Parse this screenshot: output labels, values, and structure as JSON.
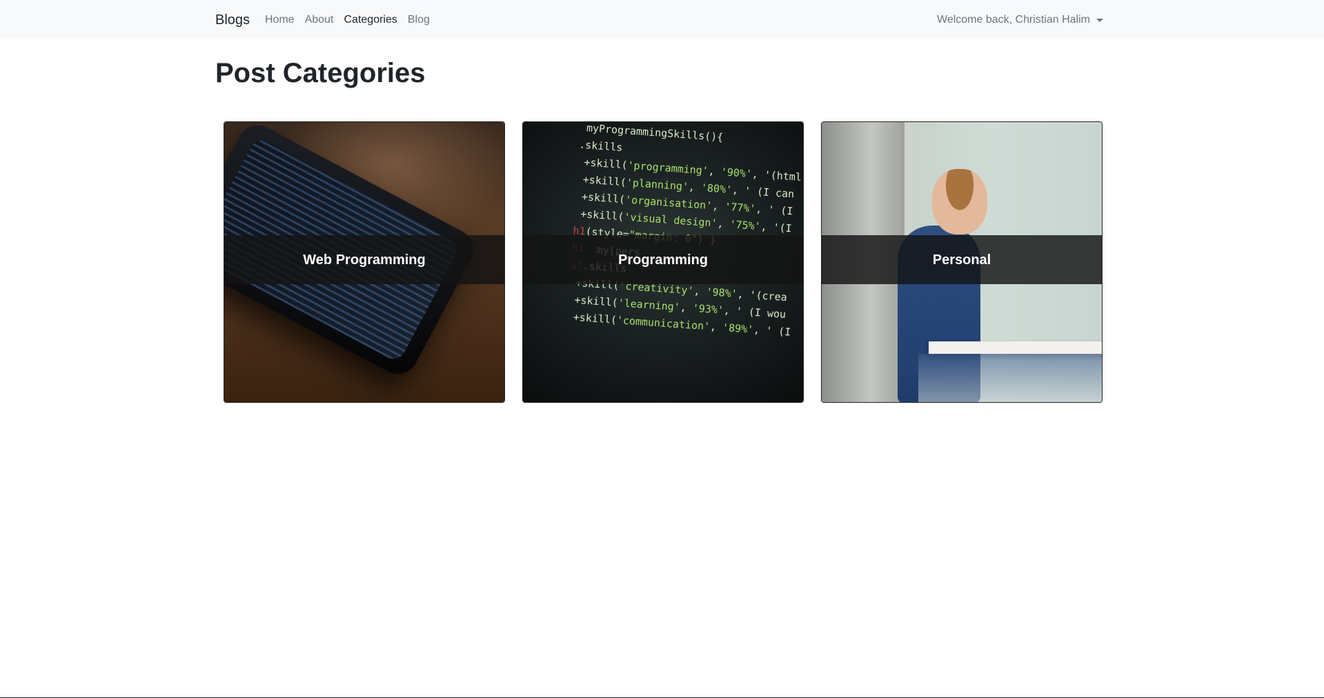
{
  "navbar": {
    "brand": "Blogs",
    "links": [
      {
        "label": "Home",
        "active": false
      },
      {
        "label": "About",
        "active": false
      },
      {
        "label": "Categories",
        "active": true
      },
      {
        "label": "Blog",
        "active": false
      }
    ],
    "user_greeting": "Welcome back, Christian Halim"
  },
  "page": {
    "title": "Post Categories"
  },
  "categories": [
    {
      "name": "Web Programming",
      "image": "phone-on-wooden-table"
    },
    {
      "name": "Programming",
      "image": "code-on-screen"
    },
    {
      "name": "Personal",
      "image": "boy-washing-hands"
    }
  ],
  "colors": {
    "navbar_bg": "#f8f9fa",
    "text_dark": "#212529",
    "text_muted": "#6c757d",
    "caption_overlay": "#141414"
  }
}
